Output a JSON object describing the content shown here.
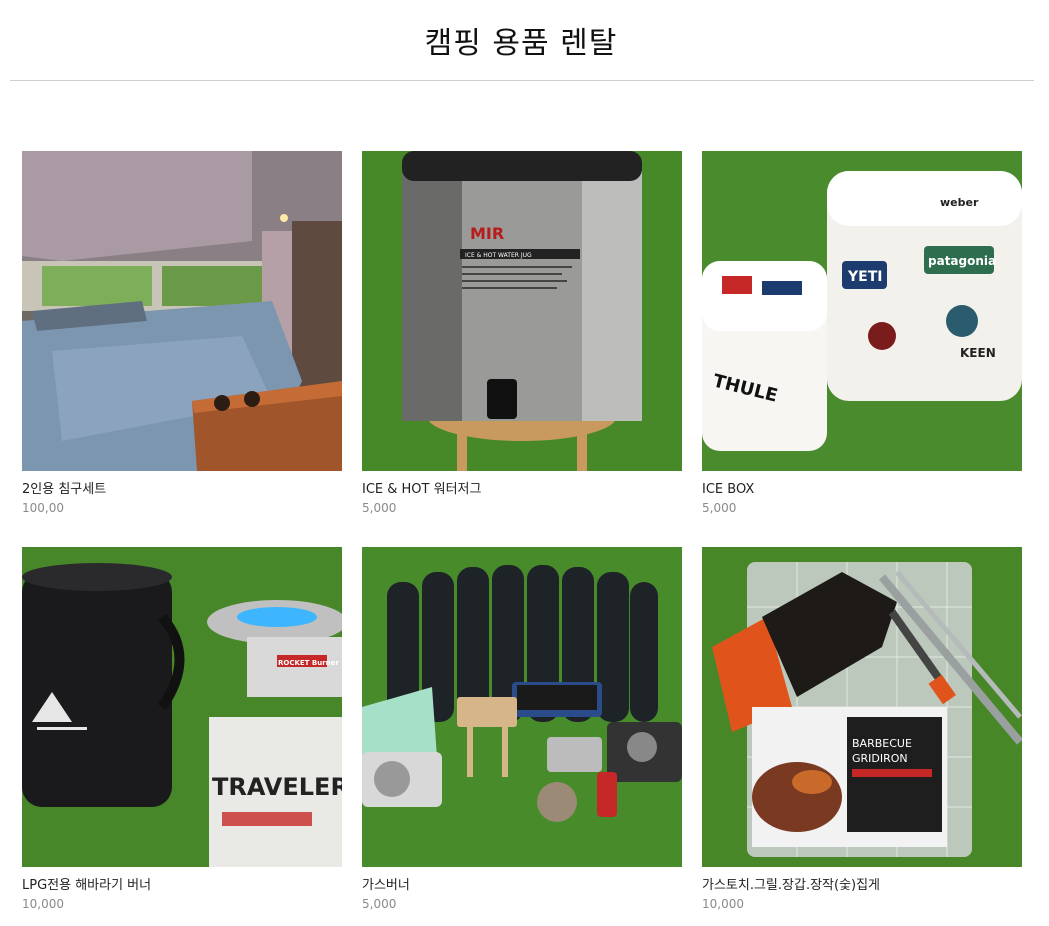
{
  "header": {
    "title": "캠핑 용품 렌탈"
  },
  "products": [
    {
      "name": "2인용 침구세트",
      "price": "100,00",
      "image": "camper-bedding"
    },
    {
      "name": "ICE & HOT 워터저그",
      "price": "5,000",
      "image": "water-jug"
    },
    {
      "name": "ICE BOX",
      "price": "5,000",
      "image": "ice-box"
    },
    {
      "name": "LPG전용 해바라기 버너",
      "price": "10,000",
      "image": "lpg-burner"
    },
    {
      "name": "가스버너",
      "price": "5,000",
      "image": "gas-burner"
    },
    {
      "name": "가스토치.그릴.장갑.장작(숯)집게",
      "price": "10,000",
      "image": "bbq-tools"
    }
  ],
  "image_text": {
    "jug_brand": "MIR",
    "jug_label": "ICE & HOT WATER JUG",
    "cooler_stickers": [
      "YETI",
      "patagonia",
      "weber",
      "THULE",
      "KEEN"
    ],
    "tank_text": "TRAVELER",
    "burner_brand": "ROCKET Burner",
    "gridiron_line1": "BARBECUE",
    "gridiron_line2": "GRIDIRON"
  },
  "colors": {
    "grass": "#4a8a2b",
    "title": "#111111",
    "price": "#8a8a8a",
    "divider": "#cfcfcf"
  }
}
